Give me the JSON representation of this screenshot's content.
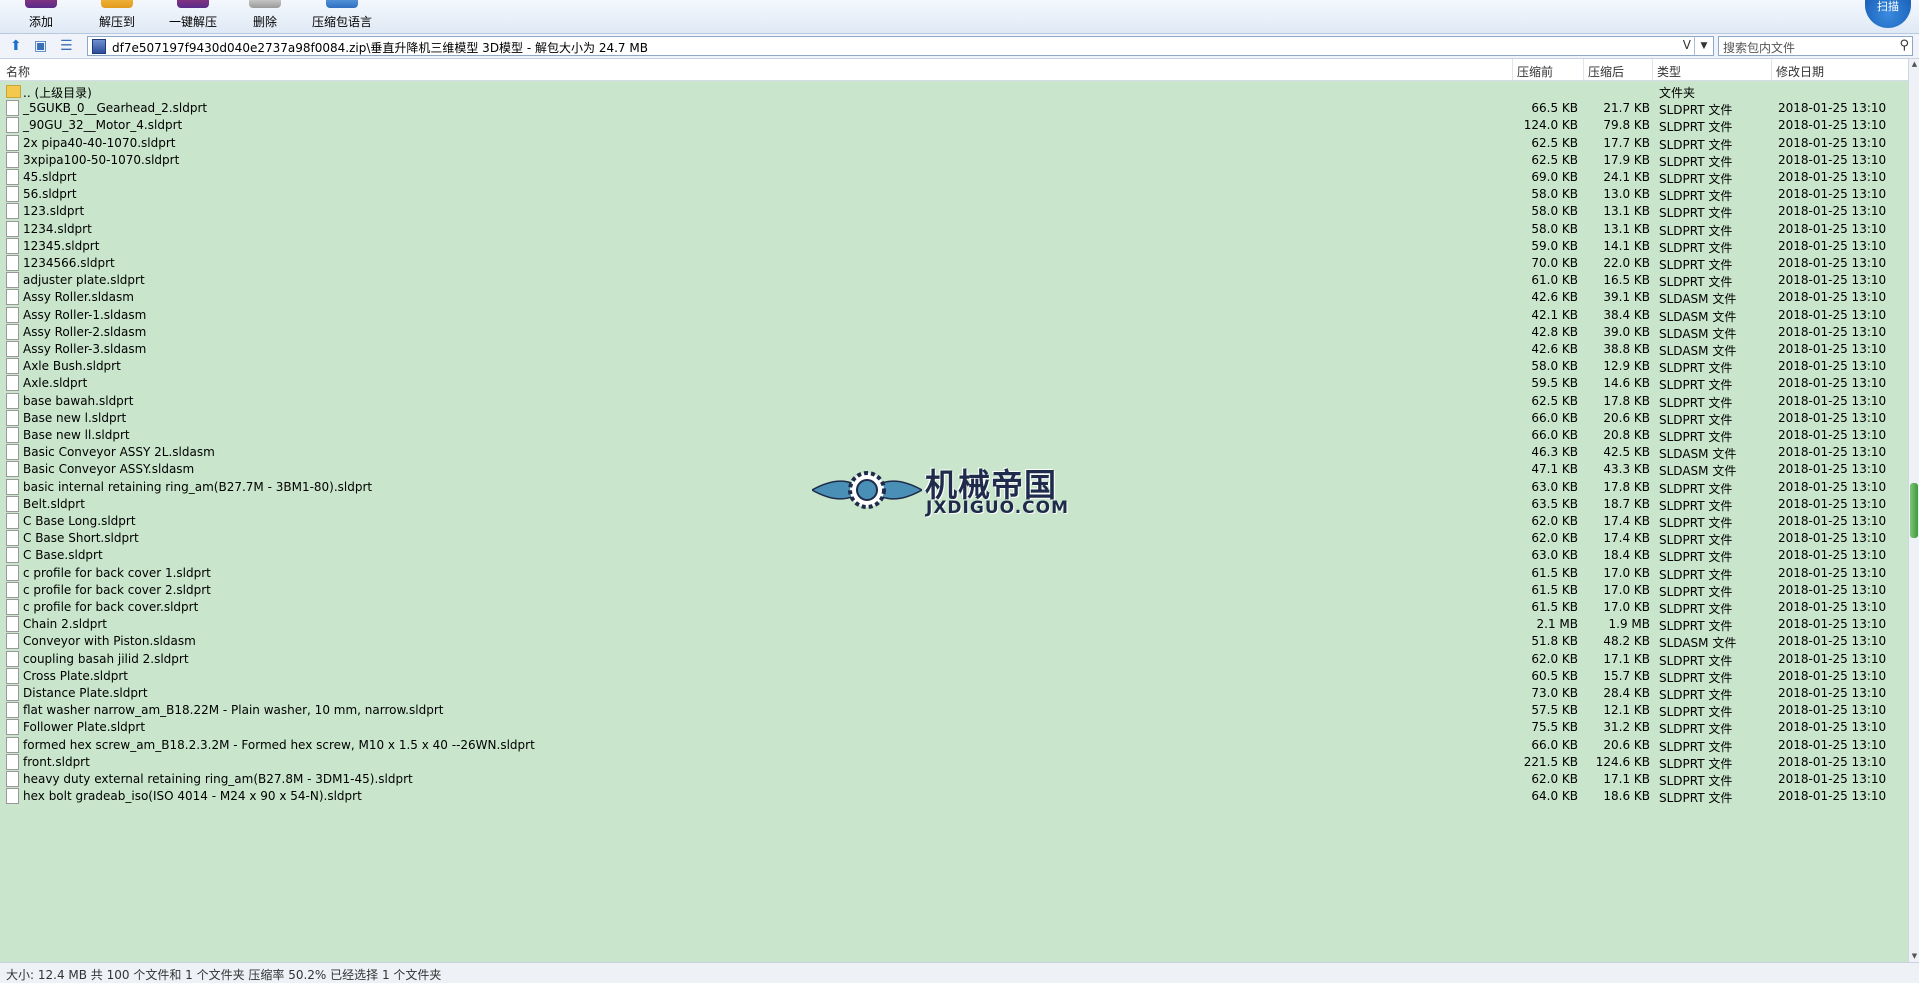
{
  "toolbar": {
    "buttons": [
      {
        "label": "添加"
      },
      {
        "label": "解压到"
      },
      {
        "label": "一键解压"
      },
      {
        "label": "删除"
      },
      {
        "label": "压缩包语言"
      }
    ],
    "shield_text": "扫描"
  },
  "address": {
    "path": "df7e507197f9430d040e2737a98f0084.zip\\垂直升降机三维模型 3D模型 - 解包大小为 24.7 MB",
    "dropdown_glyph": "V",
    "search_placeholder": "搜索包内文件"
  },
  "columns": {
    "name": "名称",
    "compressed": "压缩前",
    "uncompressed": "压缩后",
    "type": "类型",
    "modified": "修改日期"
  },
  "parent_row": {
    "name": ".. (上级目录)",
    "type": "文件夹"
  },
  "files": [
    {
      "name": "_5GUKB_0__Gearhead_2.sldprt",
      "pre": "66.5 KB",
      "post": "21.7 KB",
      "type": "SLDPRT 文件",
      "date": "2018-01-25 13:10"
    },
    {
      "name": "_90GU_32__Motor_4.sldprt",
      "pre": "124.0 KB",
      "post": "79.8 KB",
      "type": "SLDPRT 文件",
      "date": "2018-01-25 13:10"
    },
    {
      "name": "2x pipa40-40-1070.sldprt",
      "pre": "62.5 KB",
      "post": "17.7 KB",
      "type": "SLDPRT 文件",
      "date": "2018-01-25 13:10"
    },
    {
      "name": "3xpipa100-50-1070.sldprt",
      "pre": "62.5 KB",
      "post": "17.9 KB",
      "type": "SLDPRT 文件",
      "date": "2018-01-25 13:10"
    },
    {
      "name": "45.sldprt",
      "pre": "69.0 KB",
      "post": "24.1 KB",
      "type": "SLDPRT 文件",
      "date": "2018-01-25 13:10"
    },
    {
      "name": "56.sldprt",
      "pre": "58.0 KB",
      "post": "13.0 KB",
      "type": "SLDPRT 文件",
      "date": "2018-01-25 13:10"
    },
    {
      "name": "123.sldprt",
      "pre": "58.0 KB",
      "post": "13.1 KB",
      "type": "SLDPRT 文件",
      "date": "2018-01-25 13:10"
    },
    {
      "name": "1234.sldprt",
      "pre": "58.0 KB",
      "post": "13.1 KB",
      "type": "SLDPRT 文件",
      "date": "2018-01-25 13:10"
    },
    {
      "name": "12345.sldprt",
      "pre": "59.0 KB",
      "post": "14.1 KB",
      "type": "SLDPRT 文件",
      "date": "2018-01-25 13:10"
    },
    {
      "name": "1234566.sldprt",
      "pre": "70.0 KB",
      "post": "22.0 KB",
      "type": "SLDPRT 文件",
      "date": "2018-01-25 13:10"
    },
    {
      "name": "adjuster plate.sldprt",
      "pre": "61.0 KB",
      "post": "16.5 KB",
      "type": "SLDPRT 文件",
      "date": "2018-01-25 13:10"
    },
    {
      "name": "Assy Roller.sldasm",
      "pre": "42.6 KB",
      "post": "39.1 KB",
      "type": "SLDASM 文件",
      "date": "2018-01-25 13:10"
    },
    {
      "name": "Assy Roller-1.sldasm",
      "pre": "42.1 KB",
      "post": "38.4 KB",
      "type": "SLDASM 文件",
      "date": "2018-01-25 13:10"
    },
    {
      "name": "Assy Roller-2.sldasm",
      "pre": "42.8 KB",
      "post": "39.0 KB",
      "type": "SLDASM 文件",
      "date": "2018-01-25 13:10"
    },
    {
      "name": "Assy Roller-3.sldasm",
      "pre": "42.6 KB",
      "post": "38.8 KB",
      "type": "SLDASM 文件",
      "date": "2018-01-25 13:10"
    },
    {
      "name": "Axle Bush.sldprt",
      "pre": "58.0 KB",
      "post": "12.9 KB",
      "type": "SLDPRT 文件",
      "date": "2018-01-25 13:10"
    },
    {
      "name": "Axle.sldprt",
      "pre": "59.5 KB",
      "post": "14.6 KB",
      "type": "SLDPRT 文件",
      "date": "2018-01-25 13:10"
    },
    {
      "name": "base bawah.sldprt",
      "pre": "62.5 KB",
      "post": "17.8 KB",
      "type": "SLDPRT 文件",
      "date": "2018-01-25 13:10"
    },
    {
      "name": "Base new l.sldprt",
      "pre": "66.0 KB",
      "post": "20.6 KB",
      "type": "SLDPRT 文件",
      "date": "2018-01-25 13:10"
    },
    {
      "name": "Base new ll.sldprt",
      "pre": "66.0 KB",
      "post": "20.8 KB",
      "type": "SLDPRT 文件",
      "date": "2018-01-25 13:10"
    },
    {
      "name": "Basic Conveyor ASSY 2L.sldasm",
      "pre": "46.3 KB",
      "post": "42.5 KB",
      "type": "SLDASM 文件",
      "date": "2018-01-25 13:10"
    },
    {
      "name": "Basic Conveyor ASSY.sldasm",
      "pre": "47.1 KB",
      "post": "43.3 KB",
      "type": "SLDASM 文件",
      "date": "2018-01-25 13:10"
    },
    {
      "name": "basic internal retaining ring_am(B27.7M - 3BM1-80).sldprt",
      "pre": "63.0 KB",
      "post": "17.8 KB",
      "type": "SLDPRT 文件",
      "date": "2018-01-25 13:10"
    },
    {
      "name": "Belt.sldprt",
      "pre": "63.5 KB",
      "post": "18.7 KB",
      "type": "SLDPRT 文件",
      "date": "2018-01-25 13:10"
    },
    {
      "name": "C Base Long.sldprt",
      "pre": "62.0 KB",
      "post": "17.4 KB",
      "type": "SLDPRT 文件",
      "date": "2018-01-25 13:10"
    },
    {
      "name": "C Base Short.sldprt",
      "pre": "62.0 KB",
      "post": "17.4 KB",
      "type": "SLDPRT 文件",
      "date": "2018-01-25 13:10"
    },
    {
      "name": "C Base.sldprt",
      "pre": "63.0 KB",
      "post": "18.4 KB",
      "type": "SLDPRT 文件",
      "date": "2018-01-25 13:10"
    },
    {
      "name": "c profile for back cover 1.sldprt",
      "pre": "61.5 KB",
      "post": "17.0 KB",
      "type": "SLDPRT 文件",
      "date": "2018-01-25 13:10"
    },
    {
      "name": "c profile for back cover 2.sldprt",
      "pre": "61.5 KB",
      "post": "17.0 KB",
      "type": "SLDPRT 文件",
      "date": "2018-01-25 13:10"
    },
    {
      "name": "c profile for back cover.sldprt",
      "pre": "61.5 KB",
      "post": "17.0 KB",
      "type": "SLDPRT 文件",
      "date": "2018-01-25 13:10"
    },
    {
      "name": "Chain 2.sldprt",
      "pre": "2.1 MB",
      "post": "1.9 MB",
      "type": "SLDPRT 文件",
      "date": "2018-01-25 13:10"
    },
    {
      "name": "Conveyor with Piston.sldasm",
      "pre": "51.8 KB",
      "post": "48.2 KB",
      "type": "SLDASM 文件",
      "date": "2018-01-25 13:10"
    },
    {
      "name": "coupling basah jilid 2.sldprt",
      "pre": "62.0 KB",
      "post": "17.1 KB",
      "type": "SLDPRT 文件",
      "date": "2018-01-25 13:10"
    },
    {
      "name": "Cross Plate.sldprt",
      "pre": "60.5 KB",
      "post": "15.7 KB",
      "type": "SLDPRT 文件",
      "date": "2018-01-25 13:10"
    },
    {
      "name": "Distance Plate.sldprt",
      "pre": "73.0 KB",
      "post": "28.4 KB",
      "type": "SLDPRT 文件",
      "date": "2018-01-25 13:10"
    },
    {
      "name": "flat washer narrow_am_B18.22M - Plain washer, 10 mm, narrow.sldprt",
      "pre": "57.5 KB",
      "post": "12.1 KB",
      "type": "SLDPRT 文件",
      "date": "2018-01-25 13:10"
    },
    {
      "name": "Follower Plate.sldprt",
      "pre": "75.5 KB",
      "post": "31.2 KB",
      "type": "SLDPRT 文件",
      "date": "2018-01-25 13:10"
    },
    {
      "name": "formed hex screw_am_B18.2.3.2M - Formed hex screw, M10 x 1.5 x 40 --26WN.sldprt",
      "pre": "66.0 KB",
      "post": "20.6 KB",
      "type": "SLDPRT 文件",
      "date": "2018-01-25 13:10"
    },
    {
      "name": "front.sldprt",
      "pre": "221.5 KB",
      "post": "124.6 KB",
      "type": "SLDPRT 文件",
      "date": "2018-01-25 13:10"
    },
    {
      "name": "heavy duty external retaining ring_am(B27.8M - 3DM1-45).sldprt",
      "pre": "62.0 KB",
      "post": "17.1 KB",
      "type": "SLDPRT 文件",
      "date": "2018-01-25 13:10"
    },
    {
      "name": "hex bolt gradeab_iso(ISO 4014 - M24 x 90 x 54-N).sldprt",
      "pre": "64.0 KB",
      "post": "18.6 KB",
      "type": "SLDPRT 文件",
      "date": "2018-01-25 13:10"
    }
  ],
  "status": {
    "text": "大小: 12.4 MB 共 100 个文件和 1 个文件夹 压缩率 50.2% 已经选择 1 个文件夹"
  },
  "watermark": {
    "title": "机械帝国",
    "url": "JXDIGUO.COM"
  }
}
